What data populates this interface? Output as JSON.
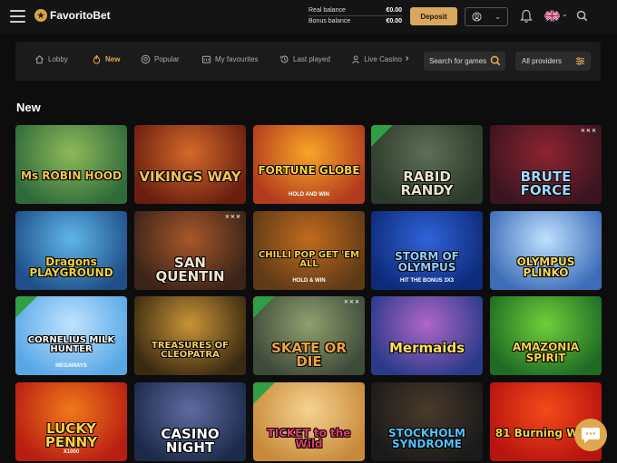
{
  "header": {
    "brand": "FavoritoBet",
    "real_balance_label": "Real balance",
    "real_balance_value": "€0.00",
    "bonus_balance_label": "Bonus balance",
    "bonus_balance_value": "€0.00",
    "deposit_label": "Deposit"
  },
  "nav": {
    "items": [
      {
        "label": "Lobby"
      },
      {
        "label": "New"
      },
      {
        "label": "Popular"
      },
      {
        "label": "My favourites"
      },
      {
        "label": "Last played"
      },
      {
        "label": "Live Casino"
      }
    ],
    "search_placeholder": "Search for games",
    "providers_label": "All providers"
  },
  "section": {
    "title": "New"
  },
  "games": [
    {
      "title": "Ms ROBIN HOOD",
      "sub": "",
      "bg1": "#2f6b3a",
      "bg2": "#8fb95a",
      "color": "#f4c84b"
    },
    {
      "title": "VIKINGS WAY",
      "sub": "",
      "bg1": "#6b1e10",
      "bg2": "#d36a2a",
      "color": "#f5c04e"
    },
    {
      "title": "FORTUNE GLOBE",
      "sub": "HOLD AND WIN",
      "bg1": "#b23a1d",
      "bg2": "#f7a627",
      "color": "#ffd23a"
    },
    {
      "title": "RABID RANDY",
      "sub": "",
      "bg1": "#2b3a2a",
      "bg2": "#5f6e56",
      "color": "#e9e4c9"
    },
    {
      "title": "BRUTE FORCE",
      "sub": "",
      "bg1": "#3a1520",
      "bg2": "#8d2430",
      "color": "#9fd7ff"
    },
    {
      "title": "Dragons PLAYGROUND",
      "sub": "",
      "bg1": "#1f4f8a",
      "bg2": "#5fb6e8",
      "color": "#f4d23c"
    },
    {
      "title": "SAN QUENTIN",
      "sub": "",
      "bg1": "#3a2418",
      "bg2": "#a8572a",
      "color": "#f0e6d0"
    },
    {
      "title": "CHILLI POP GET 'EM ALL",
      "sub": "HOLD & WIN",
      "bg1": "#5e3a16",
      "bg2": "#c26a1e",
      "color": "#ffd23a"
    },
    {
      "title": "STORM OF OLYMPUS",
      "sub": "HIT THE BONUS 3X3",
      "bg1": "#0e2a7a",
      "bg2": "#2f64d8",
      "color": "#8fd0ff"
    },
    {
      "title": "OLYMPUS PLINKO",
      "sub": "",
      "bg1": "#3d6db8",
      "bg2": "#bfe0ff",
      "color": "#f6d94e"
    },
    {
      "title": "CORNELIUS MILK HUNTER",
      "sub": "MEGAWAYS",
      "bg1": "#58a8e6",
      "bg2": "#bfe3ff",
      "color": "#ffffff"
    },
    {
      "title": "TREASURES OF CLEOPATRA",
      "sub": "",
      "bg1": "#3b2a12",
      "bg2": "#c99436",
      "color": "#f4cf5a"
    },
    {
      "title": "SKATE OR DIE",
      "sub": "",
      "bg1": "#3e4a3a",
      "bg2": "#8fa06d",
      "color": "#f2a23a"
    },
    {
      "title": "Mermaids",
      "sub": "",
      "bg1": "#2a3a8a",
      "bg2": "#b066c8",
      "color": "#ffe05a"
    },
    {
      "title": "AMAZONIA SPIRIT",
      "sub": "",
      "bg1": "#1f6b25",
      "bg2": "#6fcf3a",
      "color": "#ffd23a"
    },
    {
      "title": "LUCKY PENNY",
      "sub": "X1000",
      "bg1": "#b81d12",
      "bg2": "#f07a1a",
      "color": "#ffd23a"
    },
    {
      "title": "CASINO NIGHT",
      "sub": "",
      "bg1": "#1c2a4a",
      "bg2": "#5f6aa0",
      "color": "#ffffff"
    },
    {
      "title": "TICKET to the Wild",
      "sub": "",
      "bg1": "#c88a3a",
      "bg2": "#f6d290",
      "color": "#e23c6e"
    },
    {
      "title": "STOCKHOLM SYNDROME",
      "sub": "",
      "bg1": "#1a1a1a",
      "bg2": "#4a3a2a",
      "color": "#4fc3ff"
    },
    {
      "title": "81 Burning Wins",
      "sub": "",
      "bg1": "#b8130f",
      "bg2": "#f44a1a",
      "color": "#ffd23a"
    }
  ],
  "new_badge_indices": [
    3,
    10,
    12,
    17
  ],
  "x_tag_indices": [
    4,
    6,
    12
  ]
}
